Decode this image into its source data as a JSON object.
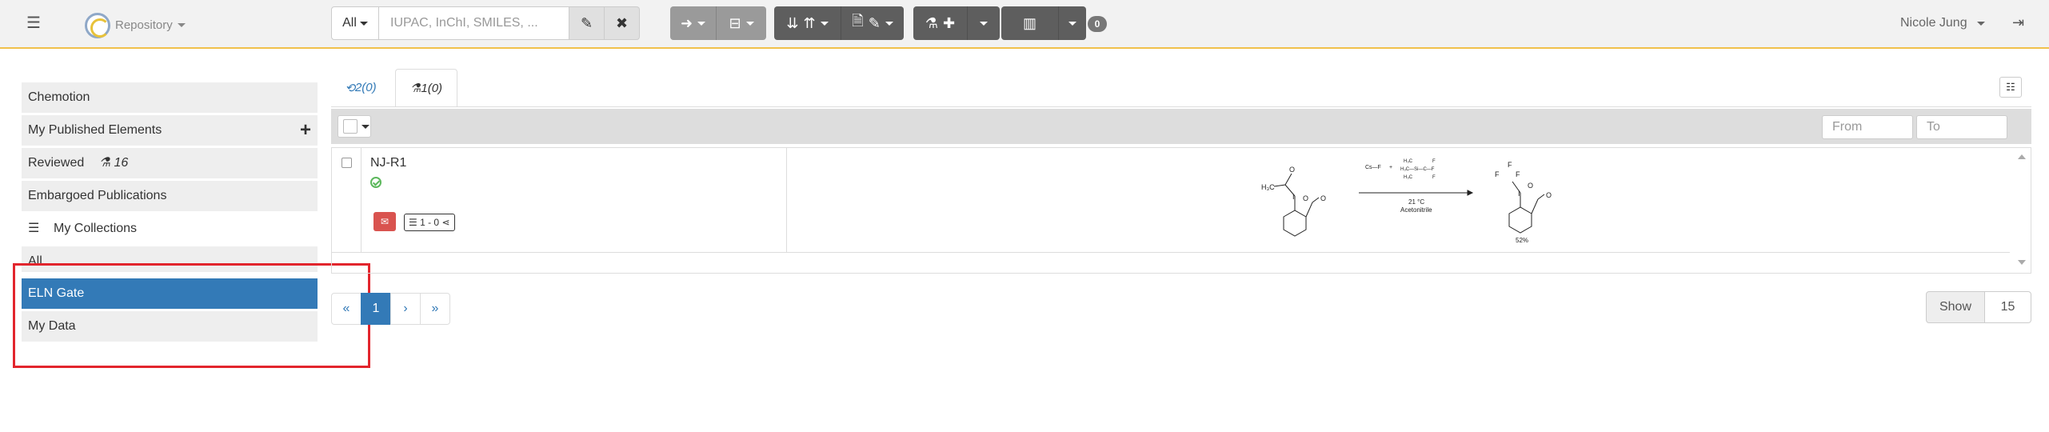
{
  "navbar": {
    "menu_icon": "list-icon",
    "repository_label": "Repository",
    "search": {
      "scope": "All",
      "placeholder": "IUPAC, InChI, SMILES, ...",
      "edit_icon": "pencil-icon",
      "clear_icon": "close-icon"
    },
    "notification_count": "0",
    "user_name": "Nicole Jung",
    "logout_icon": "sign-out-icon"
  },
  "sidebar": {
    "items": [
      {
        "label": "Chemotion"
      },
      {
        "label": "My Published Elements",
        "action_icon": "plus-icon"
      },
      {
        "label": "Reviewed",
        "count": "16"
      },
      {
        "label": "Embargoed Publications"
      },
      {
        "label": "My Collections",
        "icon": "list-icon"
      },
      {
        "label": "All"
      },
      {
        "label": "ELN Gate",
        "active": true
      },
      {
        "label": "My Data"
      }
    ]
  },
  "tabs": [
    {
      "label": "2(0)",
      "icon": "reaction-icon"
    },
    {
      "label": "1(0)",
      "icon": "flask-icon",
      "active": true
    }
  ],
  "list": {
    "from_placeholder": "From",
    "to_placeholder": "To",
    "rows": [
      {
        "name": "NJ-R1",
        "collection_badge": "1 - 0",
        "yield": "52%",
        "conditions_temp": "21 °C",
        "conditions_solvent": "Acetonitrile"
      }
    ]
  },
  "pagination": {
    "first": "«",
    "current": "1",
    "next": "›",
    "last": "»",
    "show_label": "Show",
    "show_value": "15"
  },
  "colors": {
    "active_blue": "#337ab7",
    "highlight_red": "#e2252d",
    "navbar_accent": "#f0c14b"
  }
}
